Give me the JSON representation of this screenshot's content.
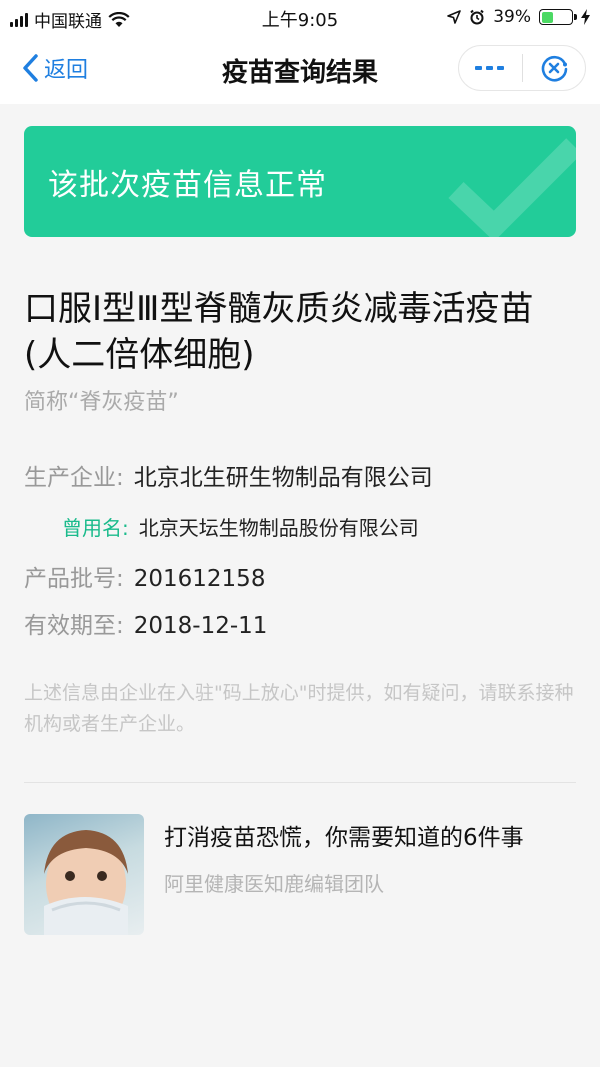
{
  "status_bar": {
    "carrier": "中国联通",
    "time": "上午9:05",
    "battery_percent": "39%",
    "battery_level": 0.39
  },
  "nav": {
    "back_label": "返回",
    "title": "疫苗查询结果"
  },
  "banner": {
    "text": "该批次疫苗信息正常",
    "color": "#22cc99"
  },
  "vaccine": {
    "name": "口服Ⅰ型Ⅲ型脊髓灰质炎减毒活疫苗(人二倍体细胞)",
    "short_name": "简称“脊灰疫苗”"
  },
  "info": {
    "manufacturer_label": "生产企业:",
    "manufacturer_value": "北京北生研生物制品有限公司",
    "alias_label": "曾用名:",
    "alias_value": "北京天坛生物制品股份有限公司",
    "batch_label": "产品批号:",
    "batch_value": "201612158",
    "expiry_label": "有效期至:",
    "expiry_value": "2018-12-11"
  },
  "notice": "上述信息由企业在入驻\"码上放心\"时提供，如有疑问，请联系接种机构或者生产企业。",
  "article": {
    "title": "打消疫苗恐慌，你需要知道的6件事",
    "author": "阿里健康医知鹿编辑团队"
  },
  "colors": {
    "accent_blue": "#1f7fe0",
    "accent_green": "#22cc99",
    "alias_green": "#1bbb8c"
  }
}
